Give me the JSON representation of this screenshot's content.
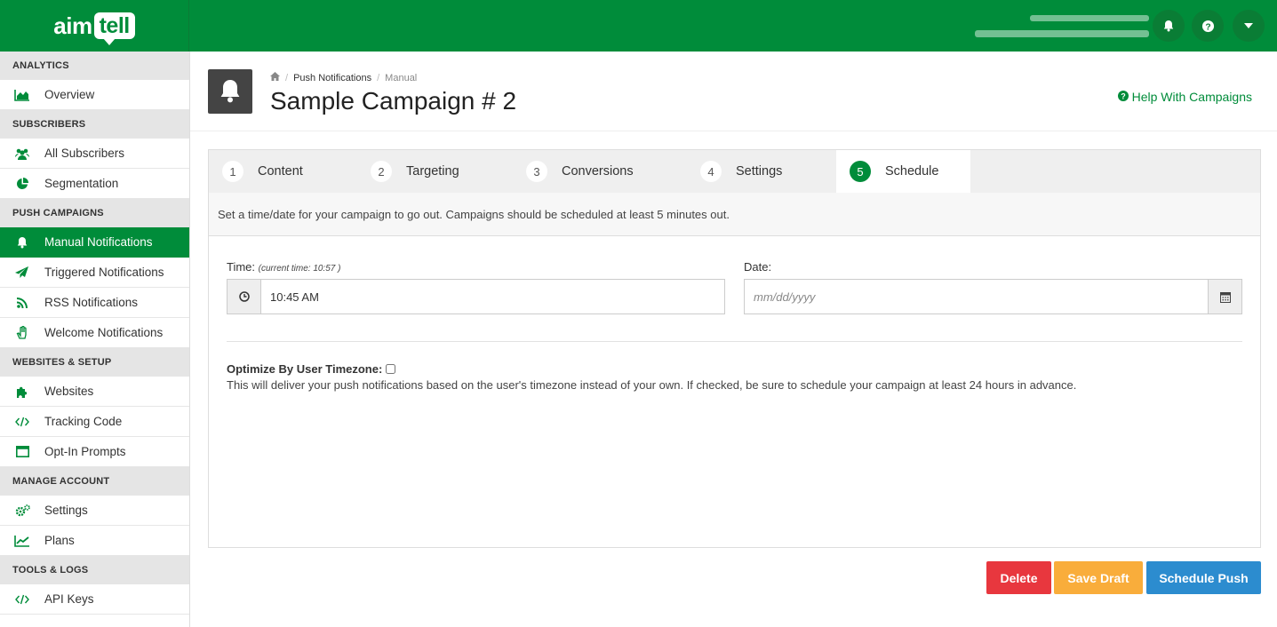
{
  "brand": {
    "logo_part1": "aim",
    "logo_part2": "tell",
    "primary_color": "#008c3a"
  },
  "topbar": {
    "buttons": [
      {
        "icon": "bell-icon"
      },
      {
        "icon": "question-circle-icon"
      },
      {
        "icon": "caret-down-icon"
      }
    ]
  },
  "sidebar": {
    "sections": [
      {
        "title": "ANALYTICS",
        "items": [
          {
            "label": "Overview",
            "icon": "area-chart-icon"
          }
        ]
      },
      {
        "title": "SUBSCRIBERS",
        "items": [
          {
            "label": "All Subscribers",
            "icon": "users-icon"
          },
          {
            "label": "Segmentation",
            "icon": "pie-chart-icon"
          }
        ]
      },
      {
        "title": "PUSH CAMPAIGNS",
        "items": [
          {
            "label": "Manual Notifications",
            "icon": "bell-icon",
            "active": true
          },
          {
            "label": "Triggered Notifications",
            "icon": "paper-plane-icon"
          },
          {
            "label": "RSS Notifications",
            "icon": "rss-icon"
          },
          {
            "label": "Welcome Notifications",
            "icon": "hand-wave-icon"
          }
        ]
      },
      {
        "title": "WEBSITES & SETUP",
        "items": [
          {
            "label": "Websites",
            "icon": "puzzle-icon"
          },
          {
            "label": "Tracking Code",
            "icon": "code-icon"
          },
          {
            "label": "Opt-In Prompts",
            "icon": "window-icon"
          }
        ]
      },
      {
        "title": "MANAGE ACCOUNT",
        "items": [
          {
            "label": "Settings",
            "icon": "gears-icon"
          },
          {
            "label": "Plans",
            "icon": "line-chart-icon"
          }
        ]
      },
      {
        "title": "TOOLS & LOGS",
        "items": [
          {
            "label": "API Keys",
            "icon": "code-icon"
          }
        ]
      }
    ]
  },
  "header": {
    "breadcrumb": {
      "link": "Push Notifications",
      "current": "Manual"
    },
    "title": "Sample Campaign # 2",
    "help_link": "Help With Campaigns"
  },
  "tabs": [
    {
      "num": "1",
      "label": "Content"
    },
    {
      "num": "2",
      "label": "Targeting"
    },
    {
      "num": "3",
      "label": "Conversions"
    },
    {
      "num": "4",
      "label": "Settings"
    },
    {
      "num": "5",
      "label": "Schedule",
      "active": true
    }
  ],
  "schedule": {
    "instructions": "Set a time/date for your campaign to go out. Campaigns should be scheduled at least 5 minutes out.",
    "time_label": "Time:",
    "current_time_note": "(current time: 10:57 )",
    "time_value": "10:45 AM",
    "date_label": "Date:",
    "date_placeholder": "mm/dd/yyyy",
    "optimize_label": "Optimize By User Timezone:",
    "optimize_checked": false,
    "optimize_description": "This will deliver your push notifications based on the user's timezone instead of your own. If checked, be sure to schedule your campaign at least 24 hours in advance."
  },
  "actions": {
    "delete": "Delete",
    "save_draft": "Save Draft",
    "schedule_push": "Schedule Push"
  }
}
